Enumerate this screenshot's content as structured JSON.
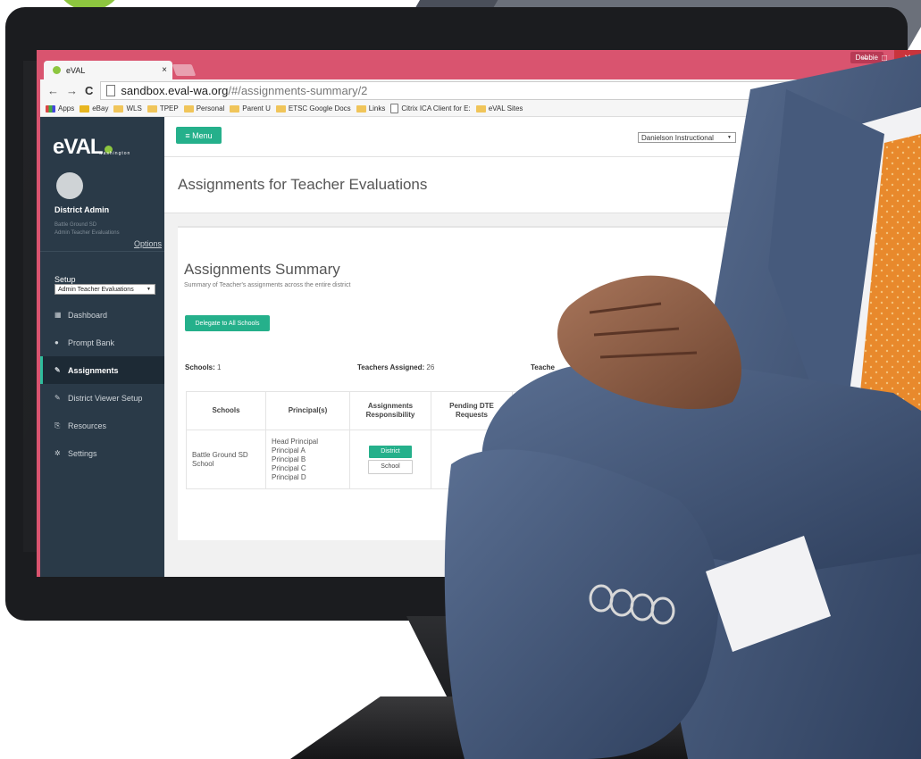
{
  "browser": {
    "tab_title": "eVAL",
    "tab_close": "×",
    "user_name": "Debbie",
    "window_buttons": {
      "minimize": "–",
      "maximize": "□",
      "close": "✕"
    },
    "nav": {
      "back": "←",
      "forward": "→",
      "reload": "C"
    },
    "url_host": "sandbox.eval-wa.org",
    "url_path": "/#/assignments-summary/2",
    "bookmarks": [
      {
        "label": "Apps",
        "icon": "apps-grid-icon"
      },
      {
        "label": "eBay",
        "icon": "ebay-icon"
      },
      {
        "label": "WLS",
        "icon": "folder-icon"
      },
      {
        "label": "TPEP",
        "icon": "folder-icon"
      },
      {
        "label": "Personal",
        "icon": "folder-icon"
      },
      {
        "label": "Parent U",
        "icon": "folder-icon"
      },
      {
        "label": "ETSC Google Docs",
        "icon": "folder-icon"
      },
      {
        "label": "Links",
        "icon": "folder-icon"
      },
      {
        "label": "Citrix ICA Client for E:",
        "icon": "page-icon"
      },
      {
        "label": "eVAL Sites",
        "icon": "folder-icon"
      }
    ]
  },
  "sidebar": {
    "brand": "eVAL",
    "brand_sub": "washington",
    "user_role": "District Admin",
    "user_district": "Battle Ground SD",
    "user_context": "Admin Teacher Evaluations",
    "options_label": "Options",
    "setup_label": "Setup",
    "setup_value": "Admin Teacher Evaluations",
    "items": [
      {
        "label": "Dashboard",
        "icon": "dashboard-icon",
        "glyph": "▦",
        "active": false
      },
      {
        "label": "Prompt Bank",
        "icon": "question-icon",
        "glyph": "●",
        "active": false
      },
      {
        "label": "Assignments",
        "icon": "link-icon",
        "glyph": "✎",
        "active": true
      },
      {
        "label": "District Viewer Setup",
        "icon": "link-icon",
        "glyph": "✎",
        "active": false
      },
      {
        "label": "Resources",
        "icon": "clipboard-icon",
        "glyph": "⎘",
        "active": false
      },
      {
        "label": "Settings",
        "icon": "gear-icon",
        "glyph": "✲",
        "active": false
      }
    ]
  },
  "topbar": {
    "menu_label": "≡ Menu",
    "framework_value": "Danielson Instructional"
  },
  "page": {
    "title": "Assignments for Teacher Evaluations"
  },
  "summary": {
    "title": "Assignments Summary",
    "subtitle": "Summary of Teacher's assignments across the entire district",
    "delegate_label": "Delegate to All Schools",
    "schools_label": "Schools:",
    "schools_value": "1",
    "teachers_assigned_label": "Teachers Assigned:",
    "teachers_assigned_value": "26",
    "teachers_label_partial": "Teache"
  },
  "table": {
    "headers": [
      "Schools",
      "Principal(s)",
      "Assignments Responsibility",
      "Pending DTE Requests"
    ],
    "rows": [
      {
        "school": "Battle Ground SD School",
        "principals": [
          "Head Principal",
          "Principal A",
          "Principal B",
          "Principal C",
          "Principal D"
        ],
        "responsibility": [
          "District",
          "School"
        ]
      }
    ]
  },
  "colors": {
    "window_frame": "#d9546f",
    "sidebar_bg": "#2a3a48",
    "accent_green": "#25b08b",
    "brand_leaf": "#8dc63f",
    "suit": "#3e5375",
    "tie": "#e8892c"
  }
}
